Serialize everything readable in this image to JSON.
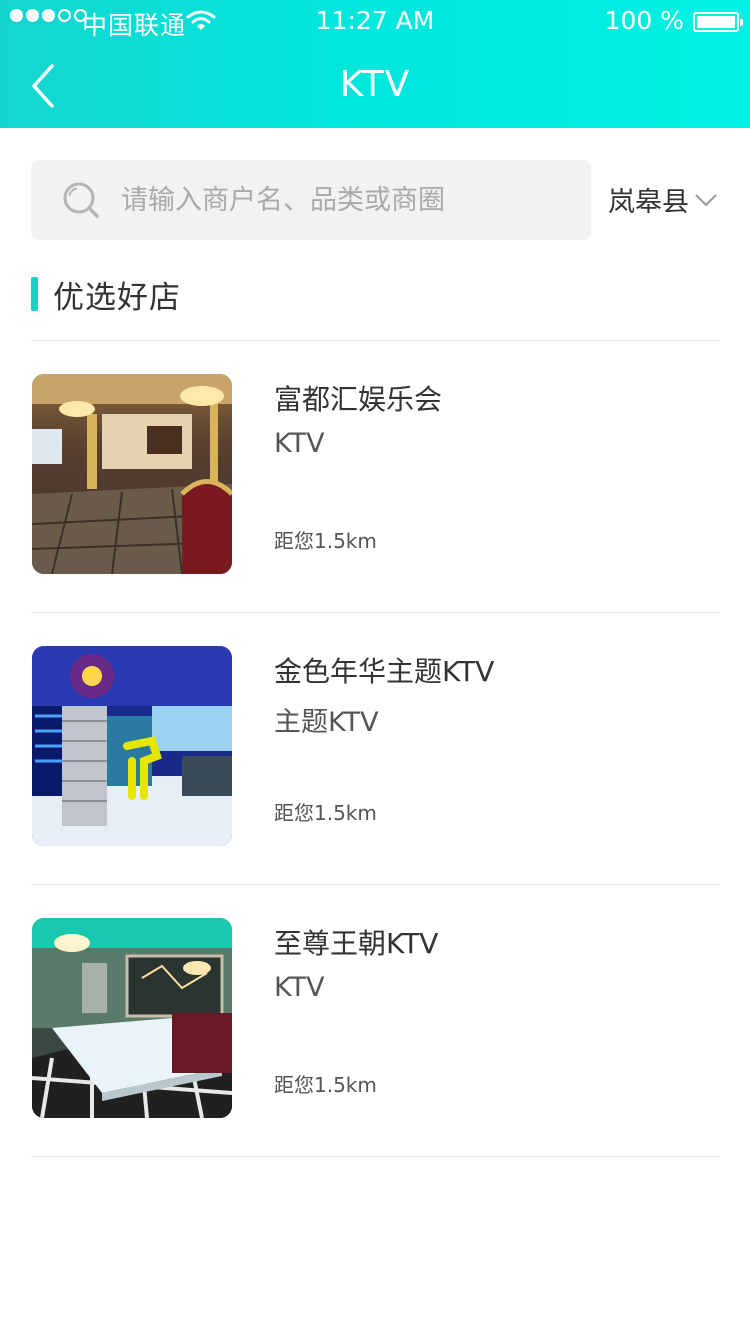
{
  "status_bar": {
    "carrier": "中国联通",
    "time": "11:27 AM",
    "battery": "100 %"
  },
  "nav": {
    "title": "KTV",
    "back_icon": "chevron-left-icon"
  },
  "search": {
    "placeholder": "请输入商户名、品类或商圈",
    "value": "",
    "icon": "search-icon"
  },
  "location": {
    "label": "岚皋县",
    "icon": "chevron-down-icon"
  },
  "section": {
    "title": "优选好店"
  },
  "colors": {
    "header_gradient_start": "#14d6cf",
    "header_gradient_end": "#00f2e4",
    "accent": "#1dcfc7"
  },
  "stores": [
    {
      "name": "富都汇娱乐会",
      "category": "KTV",
      "distance": "距您1.5km"
    },
    {
      "name": "金色年华主题KTV",
      "category": "主题KTV",
      "distance": "距您1.5km"
    },
    {
      "name": "至尊王朝KTV",
      "category": "KTV",
      "distance": "距您1.5km"
    }
  ]
}
